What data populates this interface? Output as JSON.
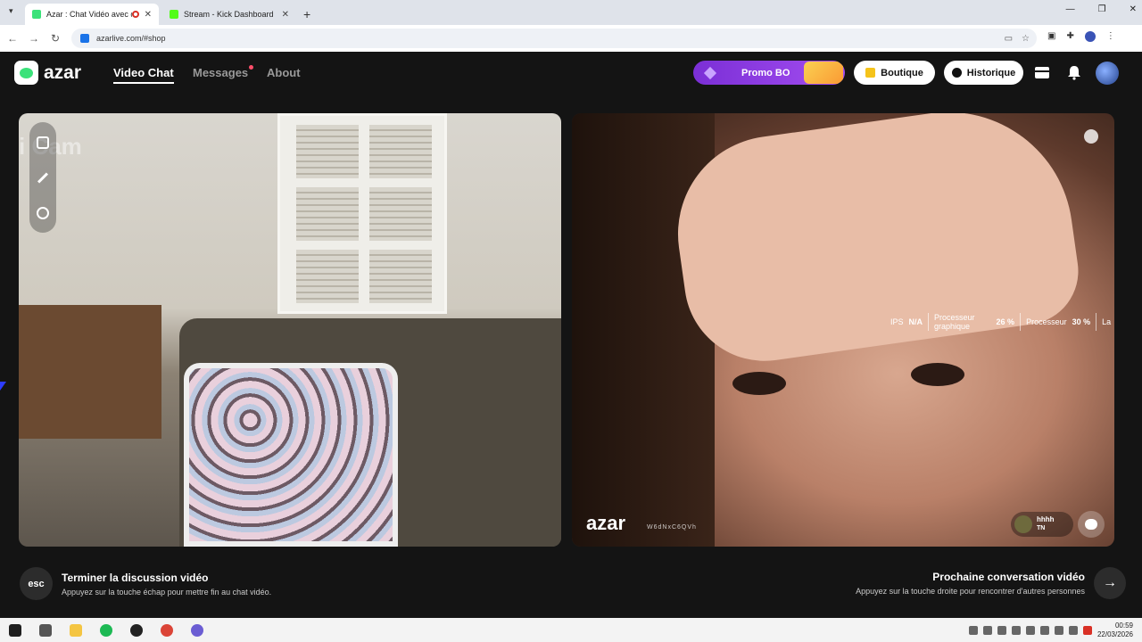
{
  "browser": {
    "tabs": [
      {
        "title": "Azar : Chat Vidéo avec de n",
        "favicon_color": "#3be27a",
        "recording": true
      },
      {
        "title": "Stream - Kick Dashboard",
        "favicon_color": "#53fc18"
      }
    ],
    "url": "azarlive.com/#shop"
  },
  "header": {
    "brand": "azar",
    "nav": {
      "video_chat": "Video Chat",
      "messages": "Messages",
      "about": "About"
    },
    "promo_label": "Promo BO",
    "boutique_label": "Boutique",
    "history_label": "Historique"
  },
  "left_video": {
    "watermark": "i Cam"
  },
  "right_video": {
    "stats": {
      "ips_label": "IPS",
      "ips_value": "N/A",
      "gpu_label_1": "Processeur",
      "gpu_label_2": "graphique",
      "gpu_value": "26 %",
      "cpu_label": "Processeur",
      "cpu_value": "30 %",
      "trailing": "La"
    },
    "watermark": "azar",
    "id_text": "W6dNxC6QVh",
    "peer_name": "hhhh",
    "peer_country": "TN"
  },
  "footer": {
    "esc_key": "esc",
    "end_title": "Terminer la discussion vidéo",
    "end_sub": "Appuyez sur la touche échap pour mettre fin au chat vidéo.",
    "next_title": "Prochaine conversation vidéo",
    "next_sub": "Appuyez sur la touche droite pour rencontrer d'autres personnes",
    "next_arrow": "→"
  },
  "taskbar": {
    "time": "00:59",
    "date": "22/03/2026"
  },
  "colors": {
    "accent_green": "#3be27a",
    "promo_purple": "#8a3de3",
    "notification_dot": "#ff4e6a"
  }
}
